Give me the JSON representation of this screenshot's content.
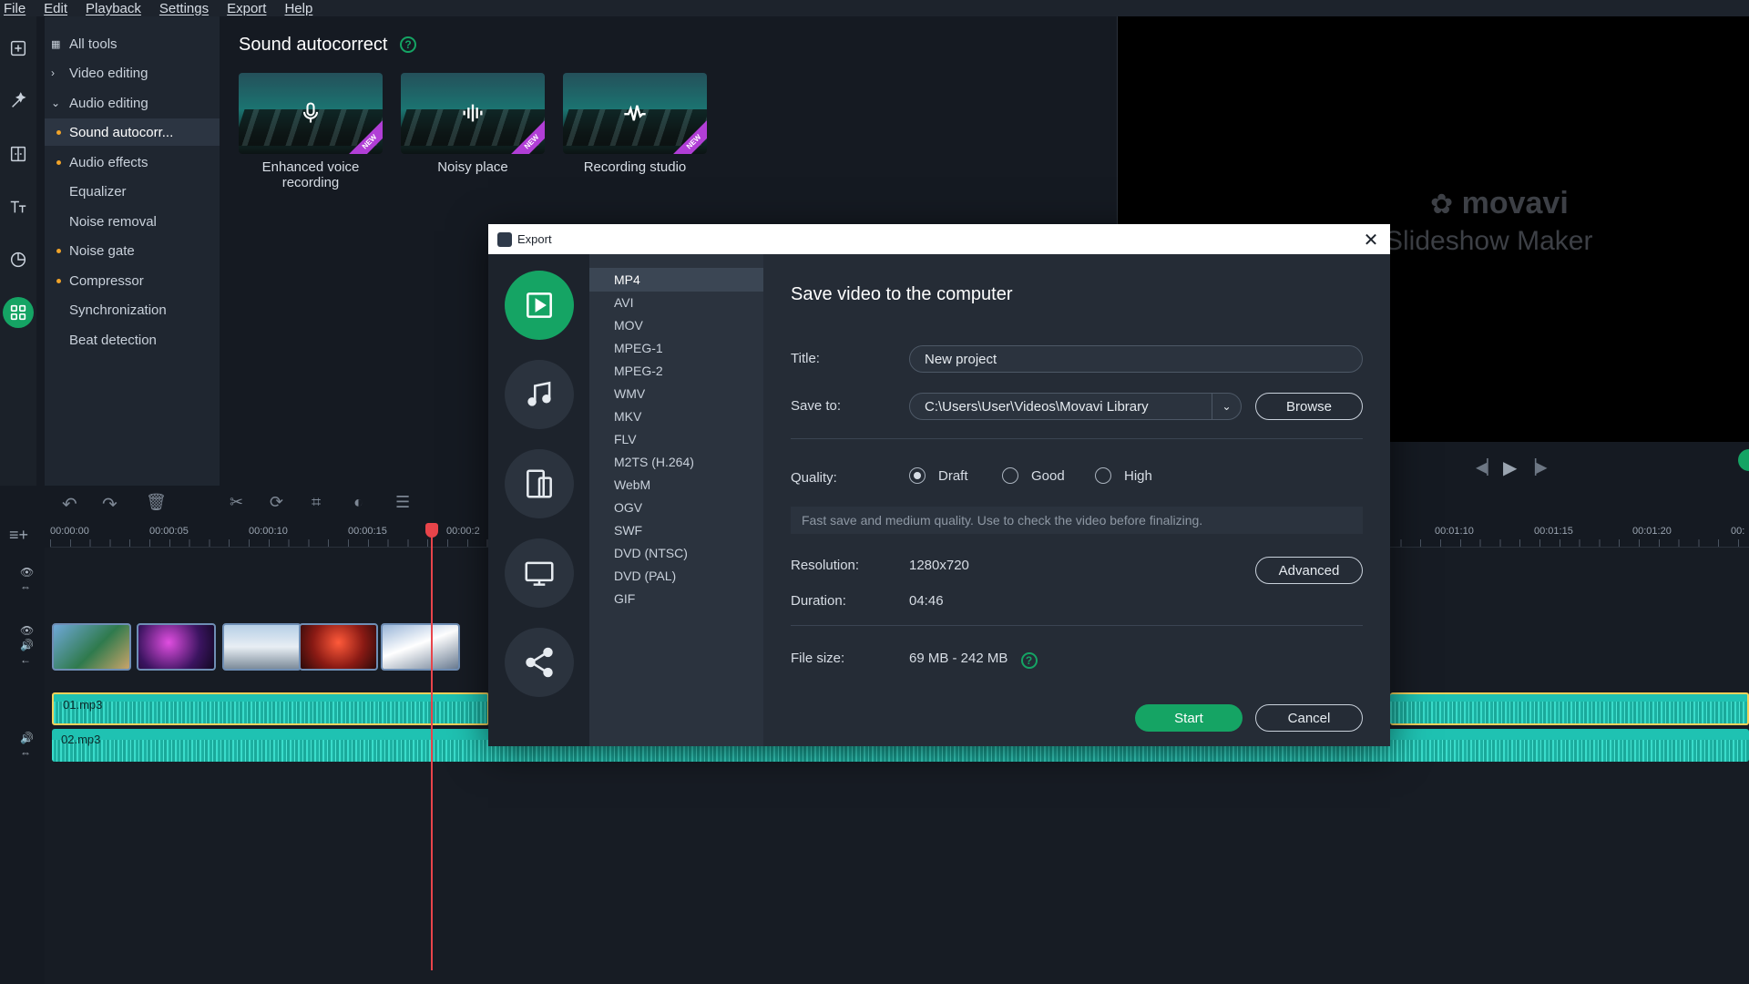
{
  "menu": [
    "File",
    "Edit",
    "Playback",
    "Settings",
    "Export",
    "Help"
  ],
  "rail_icons": [
    "import-icon",
    "magic-wand-icon",
    "transitions-icon",
    "titles-icon",
    "stickers-icon",
    "more-tools-icon"
  ],
  "tools": {
    "all_tools": "All tools",
    "video_editing": "Video editing",
    "audio_editing": "Audio editing",
    "items": [
      {
        "label": "Sound autocorr...",
        "dot": true,
        "selected": true
      },
      {
        "label": "Audio effects",
        "dot": true
      },
      {
        "label": "Equalizer",
        "dot": false
      },
      {
        "label": "Noise removal",
        "dot": false
      },
      {
        "label": "Noise gate",
        "dot": true
      },
      {
        "label": "Compressor",
        "dot": true
      },
      {
        "label": "Synchronization",
        "dot": false
      },
      {
        "label": "Beat detection",
        "dot": false
      }
    ]
  },
  "panel": {
    "title": "Sound autocorrect",
    "help": "?",
    "badge": "NEW",
    "presets": [
      {
        "label_line1": "Enhanced voice",
        "label_line2": "recording",
        "icon": "microphone-icon"
      },
      {
        "label_line1": "Noisy place",
        "label_line2": "",
        "icon": "sound-wave-icon"
      },
      {
        "label_line1": "Recording studio",
        "label_line2": "",
        "icon": "waveform-icon"
      }
    ]
  },
  "preview": {
    "logo": "movavi",
    "logo_sub": "Slideshow Maker"
  },
  "timeline": {
    "ruler_left": [
      "00:00:00",
      "00:00:05",
      "00:00:10",
      "00:00:15",
      "00:00:2"
    ],
    "ruler_right": [
      "00:01:10",
      "00:01:15",
      "00:01:20",
      "00:"
    ],
    "audio_tracks": [
      "01.mp3",
      "02.mp3"
    ]
  },
  "dialog": {
    "title": "Export",
    "heading": "Save video to the computer",
    "destinations": [
      "video-file-icon",
      "music-note-icon",
      "devices-icon",
      "tv-icon",
      "share-icon"
    ],
    "formats": [
      "MP4",
      "AVI",
      "MOV",
      "MPEG-1",
      "MPEG-2",
      "WMV",
      "MKV",
      "FLV",
      "M2TS (H.264)",
      "WebM",
      "OGV",
      "SWF",
      "DVD (NTSC)",
      "DVD (PAL)",
      "GIF"
    ],
    "selected_format": "MP4",
    "title_label": "Title:",
    "title_value": "New project",
    "save_to_label": "Save to:",
    "save_to_value": "C:\\Users\\User\\Videos\\Movavi Library",
    "browse": "Browse",
    "quality_label": "Quality:",
    "quality_options": [
      "Draft",
      "Good",
      "High"
    ],
    "quality_selected": "Draft",
    "quality_desc": "Fast save and medium quality. Use to check the video before finalizing.",
    "resolution_label": "Resolution:",
    "resolution_value": "1280x720",
    "advanced": "Advanced",
    "duration_label": "Duration:",
    "duration_value": "04:46",
    "filesize_label": "File size:",
    "filesize_value": "69 MB - 242 MB",
    "help": "?",
    "start": "Start",
    "cancel": "Cancel"
  },
  "colors": {
    "accent": "#15a464",
    "playhead": "#e8444a",
    "audio": "#1fc2b2",
    "badge": "#b13ed6"
  }
}
